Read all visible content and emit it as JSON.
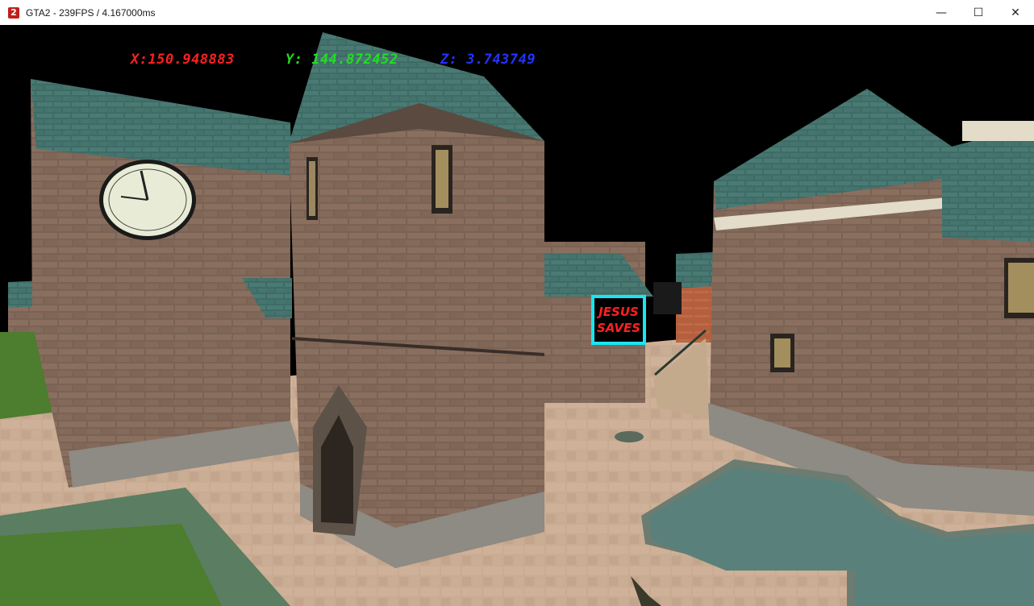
{
  "window": {
    "title": "GTA2 - 239FPS / 4.167000ms",
    "icon": "gta2-app-icon",
    "icon_glyph": "2",
    "minimize_glyph": "—",
    "maximize_glyph": "☐",
    "close_glyph": "✕"
  },
  "hud": {
    "x_text": "X:150.948883",
    "y_text": "Y: 144.872452",
    "z_text": "Z: 3.743749",
    "x_color": "#ff2020",
    "y_color": "#22dd22",
    "z_color": "#2233ff"
  },
  "scene": {
    "sign_line1": "JESUS",
    "sign_line2": "SAVES",
    "sign_border_color": "#19e6f0",
    "sign_text_color": "#ff2020",
    "roof_color": "#3f6b66",
    "brick_color": "#7a6254",
    "pavement_color": "#c8ab91",
    "water_color": "#5a807c",
    "grass_color": "#4d7d2e"
  }
}
